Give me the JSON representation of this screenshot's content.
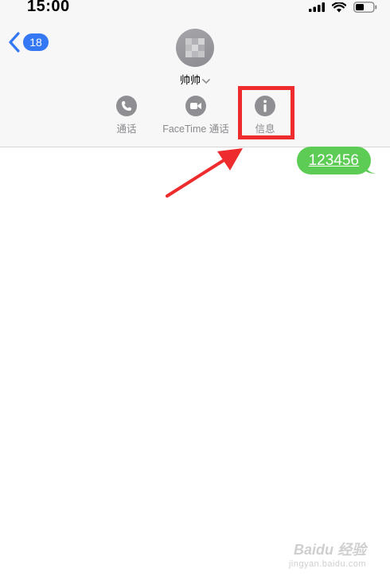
{
  "status_bar": {
    "time": "15:00",
    "icons": [
      "signal-icon",
      "wifi-icon",
      "battery-icon"
    ]
  },
  "header": {
    "back_badge": "18",
    "contact_name": "帅帅",
    "actions": [
      {
        "icon": "phone-icon",
        "label": "通话"
      },
      {
        "icon": "video-icon",
        "label": "FaceTime 通话"
      },
      {
        "icon": "info-icon",
        "label": "信息"
      }
    ]
  },
  "messages": [
    {
      "direction": "sent",
      "text": "123456"
    }
  ],
  "colors": {
    "accent": "#3478f6",
    "sent_bubble": "#5dcc55",
    "annotation": "#ee2b2d",
    "action_icon": "#8e8e93"
  },
  "watermark": {
    "main": "Baidu 经验",
    "sub": "jingyan.baidu.com"
  }
}
